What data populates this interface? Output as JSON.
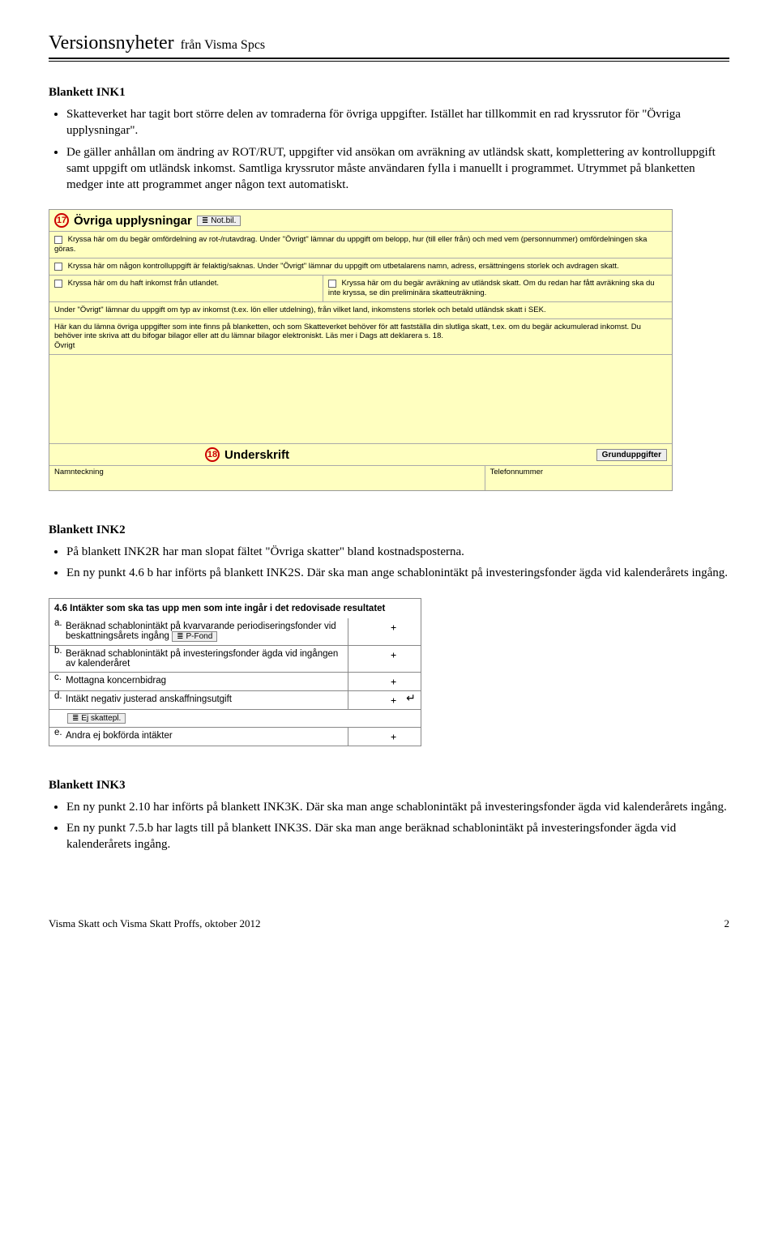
{
  "header": {
    "title": "Versionsnyheter",
    "sub": "från Visma Spcs"
  },
  "ink1": {
    "title": "Blankett INK1",
    "bullets": [
      "Skatteverket har tagit bort större delen av tomraderna för övriga uppgifter. Istället har tillkommit en rad kryssrutor för \"Övriga upplysningar\".",
      "De gäller anhållan om ändring av ROT/RUT, uppgifter vid ansökan om avräkning av utländsk skatt, komplettering av kontrolluppgift samt uppgift om utländsk inkomst. Samtliga kryssrutor måste användaren fylla i manuellt i programmet. Utrymmet på blanketten medger inte att programmet anger någon text automatiskt."
    ]
  },
  "form17": {
    "num": "17",
    "title": "Övriga upplysningar",
    "notbil": "Not.bil.",
    "r1": "Kryssa här om du begär omfördelning av rot-/rutavdrag. Under \"Övrigt\" lämnar du uppgift om belopp, hur (till eller från) och med vem (personnummer) omfördelningen ska göras.",
    "r2": "Kryssa här om någon kontrolluppgift är felaktig/saknas. Under \"Övrigt\" lämnar du uppgift om utbetalarens namn, adress, ersättningens storlek och avdragen skatt.",
    "r3_left": "Kryssa här om du haft inkomst från utlandet.",
    "r3_right_a": "Kryssa här om du begär avräkning av utländsk skatt. Om du redan har fått avräkning ska du inte kryssa, se din preliminära skatteuträkning.",
    "r3_under": "Under \"Övrigt\" lämnar du uppgift om typ av inkomst (t.ex. lön eller utdelning), från vilket land, inkomstens storlek och betald utländsk skatt i SEK.",
    "r4": "Här kan du lämna övriga uppgifter som inte finns på blanketten, och som Skatteverket behöver för att fastställa din slutliga skatt, t.ex. om du begär ackumulerad inkomst. Du behöver inte skriva att du bifogar bilagor eller att du lämnar bilagor elektroniskt. Läs mer i Dags att deklarera s. 18.",
    "ovrigt": "Övrigt"
  },
  "form18": {
    "num": "18",
    "title": "Underskrift",
    "grund": "Grunduppgifter",
    "name": "Namnteckning",
    "tel": "Telefonnummer"
  },
  "ink2": {
    "title": "Blankett INK2",
    "bullets": [
      "På blankett INK2R har man slopat fältet \"Övriga skatter\" bland kostnadsposterna.",
      "En ny punkt 4.6 b har införts på blankett INK2S. Där ska man ange schablonintäkt på investeringsfonder ägda vid kalenderårets ingång."
    ]
  },
  "ink2form": {
    "head": "4.6 Intäkter som ska tas upp men som inte ingår i det redovisade resultatet",
    "a_label": "a.",
    "a_text": "Beräknad schablonintäkt på kvarvarande periodiseringsfonder vid beskattningsårets ingång",
    "pfond": "P-Fond",
    "b_label": "b.",
    "b_text": "Beräknad schablonintäkt på investeringsfonder ägda vid ingången av kalenderåret",
    "c_label": "c.",
    "c_text": "Mottagna koncernbidrag",
    "d_label": "d.",
    "d_text": "Intäkt negativ justerad anskaffningsutgift",
    "ejskat": "Ej skattepl.",
    "e_label": "e.",
    "e_text": "Andra ej bokförda intäkter",
    "plus": "+",
    "arrow": "↵"
  },
  "ink3": {
    "title": "Blankett INK3",
    "bullets": [
      "En ny punkt 2.10 har införts på blankett INK3K. Där ska man ange schablonintäkt på investeringsfonder ägda vid kalenderårets ingång.",
      "En ny punkt 7.5.b har lagts till på blankett INK3S. Där ska man ange beräknad schablonintäkt på investeringsfonder ägda vid kalenderårets ingång."
    ]
  },
  "footer": {
    "left": "Visma Skatt och Visma Skatt Proffs, oktober 2012",
    "page": "2"
  }
}
